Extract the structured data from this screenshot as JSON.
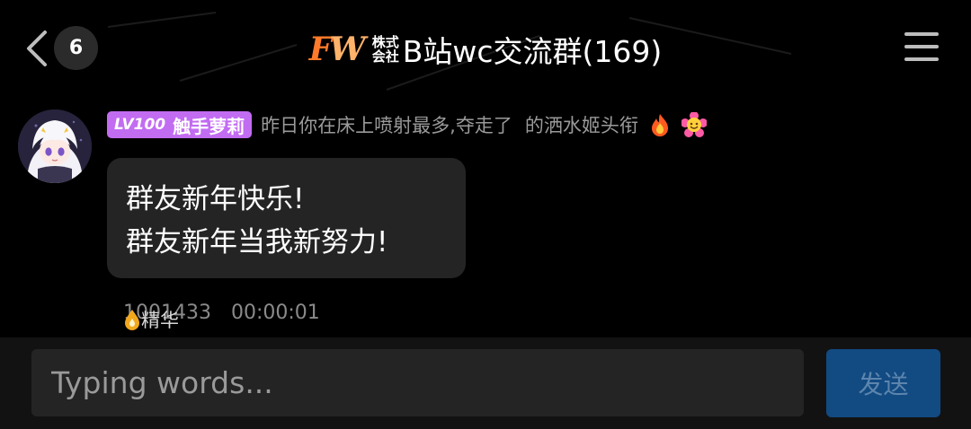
{
  "header": {
    "unread_count": "6",
    "logo_text_1": "F",
    "logo_text_2": "W",
    "company_tag_line1": "株式",
    "company_tag_line2": "会社",
    "group_title": "B站wc交流群(169)"
  },
  "icons": {
    "back": "chevron-left-icon",
    "menu": "hamburger-menu-icon",
    "fire": "fire-emoji-icon",
    "smiley": "flower-smiley-emoji-icon",
    "essence": "flame-drop-icon"
  },
  "message": {
    "level_label": "LV100",
    "nickname": "触手萝莉",
    "member_title": "昨日你在床上喷射最多,夺走了",
    "member_title_suffix": "的洒水姬头衔",
    "lines": [
      "群友新年快乐!",
      "群友新年当我新努力!"
    ],
    "meta_id": "1001433",
    "meta_time": "00:00:01",
    "essence_label": "精华"
  },
  "input": {
    "placeholder": "Typing words...",
    "value": "",
    "send_label": "发送"
  },
  "colors": {
    "background": "#000000",
    "level_badge": "#c26cf2",
    "bubble": "#242424",
    "send_button": "#124a82",
    "send_text": "#5c85ad"
  }
}
